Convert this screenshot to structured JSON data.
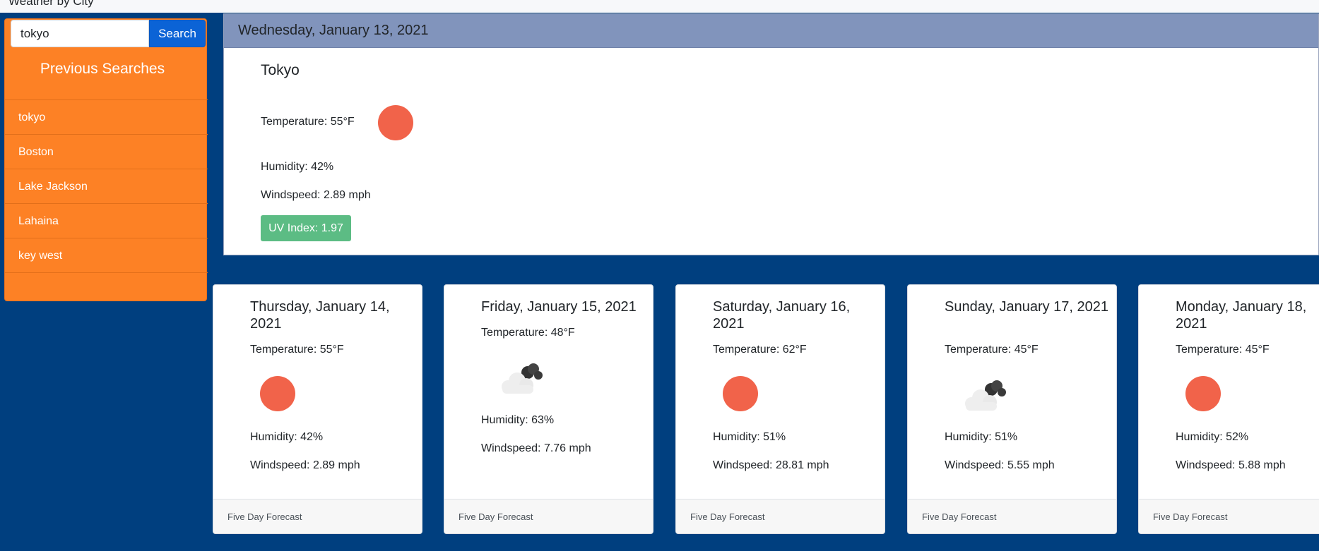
{
  "app": {
    "title": "Weather by City"
  },
  "search": {
    "value": "tokyo",
    "button_label": "Search"
  },
  "sidebar": {
    "heading": "Previous Searches",
    "items": [
      "tokyo",
      "Boston",
      "Lake Jackson",
      "Lahaina",
      "key west"
    ]
  },
  "current": {
    "date": "Wednesday, January 13, 2021",
    "city": "Tokyo",
    "temperature": "Temperature: 55°F",
    "humidity": "Humidity: 42%",
    "windspeed": "Windspeed: 2.89 mph",
    "uv_index": "UV Index: 1.97",
    "icon": "sun-icon"
  },
  "forecast": [
    {
      "date": "Thursday, January 14, 2021",
      "temperature": "Temperature: 55°F",
      "humidity": "Humidity: 42%",
      "windspeed": "Windspeed: 2.89 mph",
      "icon": "sun-icon",
      "footer": "Five Day Forecast"
    },
    {
      "date": "Friday, January 15, 2021",
      "temperature": "Temperature: 48°F",
      "humidity": "Humidity: 63%",
      "windspeed": "Windspeed: 7.76 mph",
      "icon": "cloud-icon",
      "footer": "Five Day Forecast"
    },
    {
      "date": "Saturday, January 16, 2021",
      "temperature": "Temperature: 62°F",
      "humidity": "Humidity: 51%",
      "windspeed": "Windspeed: 28.81 mph",
      "icon": "sun-icon",
      "footer": "Five Day Forecast"
    },
    {
      "date": "Sunday, January 17, 2021",
      "temperature": "Temperature: 45°F",
      "humidity": "Humidity: 51%",
      "windspeed": "Windspeed: 5.55 mph",
      "icon": "cloud-icon",
      "footer": "Five Day Forecast"
    },
    {
      "date": "Monday, January 18, 2021",
      "temperature": "Temperature: 45°F",
      "humidity": "Humidity: 52%",
      "windspeed": "Windspeed: 5.88 mph",
      "icon": "sun-icon",
      "footer": "Five Day Forecast"
    }
  ],
  "colors": {
    "background": "#003f7f",
    "sidebar": "#fd8125",
    "header": "#8194bc",
    "search_button": "#0b63d6",
    "uv_badge": "#5cbc84",
    "sun": "#f1634a"
  }
}
